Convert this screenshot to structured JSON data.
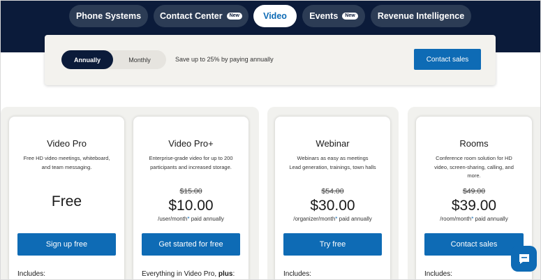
{
  "nav": {
    "tabs": [
      {
        "label": "Phone Systems",
        "badge": ""
      },
      {
        "label": "Contact Center",
        "badge": "New"
      },
      {
        "label": "Video",
        "badge": "",
        "active": true
      },
      {
        "label": "Events",
        "badge": "New"
      },
      {
        "label": "Revenue Intelligence",
        "badge": ""
      }
    ]
  },
  "billing": {
    "annually": "Annually",
    "monthly": "Monthly",
    "selected": "Annually",
    "save_note": "Save up to 25% by paying annually",
    "contact_sales": "Contact sales"
  },
  "plans": [
    {
      "name": "Video Pro",
      "description": "Free HD video meetings, whiteboard, and team messaging.",
      "price_label": "Free",
      "cta": "Sign up free",
      "includes": "Includes:"
    },
    {
      "name": "Video Pro+",
      "description": "Enterprise-grade video for up to 200 participants and increased storage.",
      "old_price": "$15.00",
      "price": "$10.00",
      "unit": "/user/month",
      "billing_note": " paid annually",
      "cta": "Get started for free",
      "includes_prefix": "Everything in Video Pro, ",
      "includes_bold": "plus",
      "includes_suffix": ":"
    },
    {
      "name": "Webinar",
      "description_line1": "Webinars as easy as meetings",
      "description_line2": "Lead generation, trainings, town halls",
      "old_price": "$54.00",
      "price": "$30.00",
      "unit": "/organizer/month",
      "billing_note": " paid annually",
      "cta": "Try free",
      "includes": "Includes:"
    },
    {
      "name": "Rooms",
      "description": "Conference room solution for HD video, screen-sharing, calling, and more.",
      "old_price": "$49.00",
      "price": "$39.00",
      "unit": "/room/month",
      "billing_note": " paid annually",
      "cta": "Contact sales",
      "includes": "Includes:"
    }
  ],
  "footnote_marker": "*",
  "colors": {
    "navy": "#0b1b3a",
    "tab_bg": "#2c3c55",
    "accent_blue": "#0e6bb5",
    "panel_bg": "#f3f2ee"
  },
  "icons": {
    "chat": "chat-bubble-icon"
  }
}
